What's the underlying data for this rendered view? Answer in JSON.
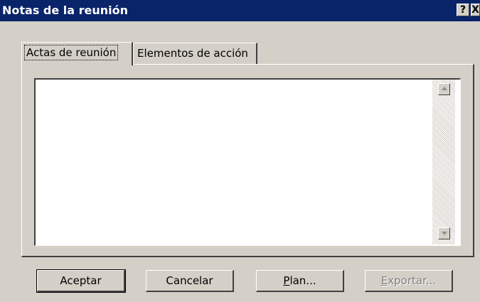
{
  "window": {
    "title": "Notas de la reunión",
    "help_label": "?",
    "close_label": "X"
  },
  "tabs": [
    {
      "label": "Actas de reunión",
      "active": true
    },
    {
      "label": "Elementos de acción",
      "active": false
    }
  ],
  "notes_text": {
    "value": ""
  },
  "buttons": {
    "accept": {
      "label": "Aceptar"
    },
    "cancel": {
      "label": "Cancelar"
    },
    "plan": {
      "mnemonic": "P",
      "rest": "lan..."
    },
    "export": {
      "mnemonic": "E",
      "rest": "xportar...",
      "enabled": false
    }
  },
  "colors": {
    "titlebar": "#0a246a",
    "face": "#d4d0c8",
    "disabled_text": "#808080"
  }
}
